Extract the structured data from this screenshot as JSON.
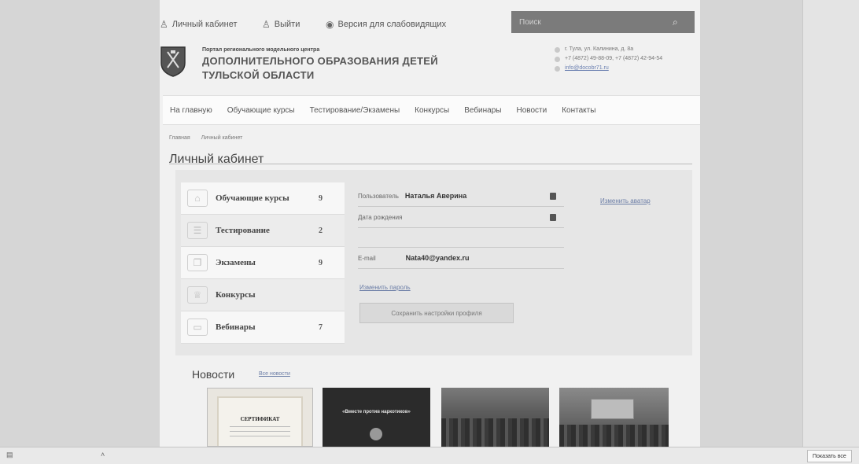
{
  "topbar": {
    "cabinet_label": "Личный кабинет",
    "logout_label": "Выйти",
    "low_vision_label": "Версия для слабовидящих",
    "search_placeholder": "Поиск"
  },
  "header": {
    "subtitle": "Портал регионального модельного центра",
    "title_line1": "ДОПОЛНИТЕЛЬНОГО ОБРАЗОВАНИЯ ДЕТЕЙ",
    "title_line2": "ТУЛЬСКОЙ ОБЛАСТИ",
    "address": "г. Тула, ул. Калинина, д. 8а",
    "phones": "+7 (4872) 49-88-09, +7 (4872) 42-94-54",
    "email": "info@docobr71.ru"
  },
  "nav": [
    "На главную",
    "Обучающие курсы",
    "Тестирование/Экзамены",
    "Конкурсы",
    "Вебинары",
    "Новости",
    "Контакты"
  ],
  "breadcrumb": {
    "home": "Главная",
    "current": "Личный кабинет"
  },
  "page_title": "Личный кабинет",
  "cabinet": {
    "menu": [
      {
        "label": "Обучающие курсы",
        "count": "9",
        "icon": "graduation-cap-icon"
      },
      {
        "label": "Тестирование",
        "count": "2",
        "icon": "checklist-icon"
      },
      {
        "label": "Экзамены",
        "count": "9",
        "icon": "documents-icon"
      },
      {
        "label": "Конкурсы",
        "count": "",
        "icon": "trophy-icon"
      },
      {
        "label": "Вебинары",
        "count": "7",
        "icon": "monitor-icon"
      }
    ],
    "user_label": "Пользователь",
    "user_name": "Наталья Аверина",
    "birth_label": "Дата рождения",
    "email_label": "E-mail",
    "email_value": "Nata40@yandex.ru",
    "change_password": "Изменить пароль",
    "save_button": "Сохранить настройки профиля",
    "change_avatar": "Изменить аватар"
  },
  "news": {
    "title": "Новости",
    "all_link": "Все новости",
    "thumb1_text": "СЕРТИФИКАТ",
    "thumb2_text": "«Вместе против наркотиков»"
  },
  "bottombar": {
    "show_all": "Показать все"
  }
}
